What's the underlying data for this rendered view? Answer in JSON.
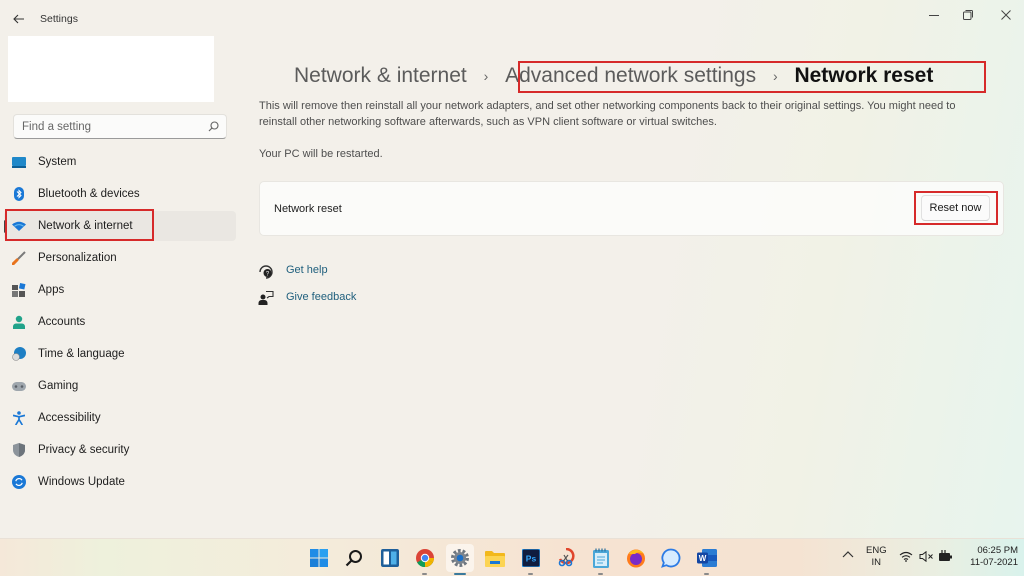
{
  "window": {
    "app_title": "Settings",
    "controls": {
      "minimize": "minimize-icon",
      "maximize": "restore-icon",
      "close": "close-icon"
    }
  },
  "sidebar": {
    "search": {
      "placeholder": "Find a setting",
      "value": ""
    },
    "items": [
      {
        "label": "System",
        "icon": "system-icon",
        "active": false
      },
      {
        "label": "Bluetooth & devices",
        "icon": "bluetooth-icon",
        "active": false
      },
      {
        "label": "Network & internet",
        "icon": "wifi-icon",
        "active": true
      },
      {
        "label": "Personalization",
        "icon": "brush-icon",
        "active": false
      },
      {
        "label": "Apps",
        "icon": "apps-icon",
        "active": false
      },
      {
        "label": "Accounts",
        "icon": "person-icon",
        "active": false
      },
      {
        "label": "Time & language",
        "icon": "globe-clock-icon",
        "active": false
      },
      {
        "label": "Gaming",
        "icon": "gamepad-icon",
        "active": false
      },
      {
        "label": "Accessibility",
        "icon": "accessibility-icon",
        "active": false
      },
      {
        "label": "Privacy & security",
        "icon": "shield-icon",
        "active": false
      },
      {
        "label": "Windows Update",
        "icon": "update-icon",
        "active": false
      }
    ]
  },
  "main": {
    "breadcrumb": [
      "Network & internet",
      "Advanced network settings",
      "Network reset"
    ],
    "description": "This will remove then reinstall all your network adapters, and set other networking components back to their original settings. You might need to reinstall other networking software afterwards, such as VPN client software or virtual switches.",
    "restart_note": "Your PC will be restarted.",
    "card": {
      "label": "Network reset",
      "button_label": "Reset now"
    },
    "links": [
      {
        "label": "Get help",
        "icon": "help-icon"
      },
      {
        "label": "Give feedback",
        "icon": "feedback-icon"
      }
    ]
  },
  "highlight_color": "#d62a2a",
  "taskbar": {
    "apps": [
      {
        "name": "start",
        "icon": "windows-logo-icon",
        "running": false
      },
      {
        "name": "search",
        "icon": "search-icon",
        "running": false
      },
      {
        "name": "widgets",
        "icon": "widgets-icon",
        "running": false
      },
      {
        "name": "chrome",
        "icon": "chrome-icon",
        "running": true
      },
      {
        "name": "settings",
        "icon": "settings-gear-icon",
        "running": true,
        "active": true
      },
      {
        "name": "file-explorer",
        "icon": "folder-icon",
        "running": false
      },
      {
        "name": "photoshop",
        "icon": "photoshop-icon",
        "running": true,
        "text": "Ps"
      },
      {
        "name": "snipping-tool",
        "icon": "snipping-tool-icon",
        "running": false
      },
      {
        "name": "notepad",
        "icon": "notepad-icon",
        "running": true
      },
      {
        "name": "firefox",
        "icon": "firefox-icon",
        "running": false
      },
      {
        "name": "signal",
        "icon": "chat-bubble-icon",
        "running": false
      },
      {
        "name": "word",
        "icon": "word-icon",
        "running": true,
        "text": "W"
      }
    ],
    "tray": {
      "language": "ENG",
      "region": "IN",
      "time": "06:25 PM",
      "date": "11-07-2021"
    }
  }
}
